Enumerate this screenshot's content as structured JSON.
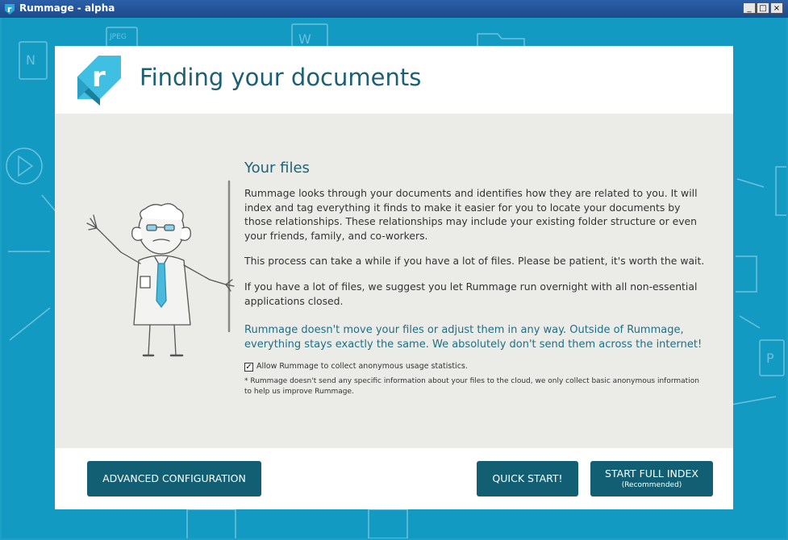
{
  "window": {
    "title": "Rummage - alpha",
    "controls": {
      "minimize": "_",
      "maximize": "□",
      "close": "×"
    }
  },
  "header": {
    "logo_letter": "r",
    "title": "Finding your documents"
  },
  "content": {
    "section_title": "Your files",
    "paragraphs": [
      "Rummage looks through your documents and identifies how they are related to you. It will index and tag everything it finds to make it easier for you to locate your documents by those relationships. These relationships may include your existing folder structure or even your friends, family, and co-workers.",
      "This process can take a while if you have a lot of files. Please be patient, it's worth the wait.",
      "If you have a lot of files, we suggest you let Rummage run overnight with all non-essential applications closed.",
      "Rummage doesn't move your files or adjust them in any way. Outside of Rummage, everything stays exactly the same. We absolutely don't send them across the internet!"
    ],
    "checkbox": {
      "label": "Allow Rummage to collect anonymous usage statistics.",
      "checked": true,
      "mark": "✓"
    },
    "footnote": "* Rummage doesn't send any specific information about your files to the cloud, we only collect basic anonymous information to help us improve Rummage."
  },
  "footer": {
    "advanced_label": "ADVANCED CONFIGURATION",
    "quick_label": "QUICK START!",
    "full_label": "START FULL INDEX",
    "full_sublabel": "(Recommended)"
  },
  "colors": {
    "background": "#139ac3",
    "button": "#125f73",
    "heading": "#1d5f73",
    "logo_light": "#3fc0e3",
    "logo_dark": "#1a7f9c"
  },
  "icons": [
    "rummage-logo-icon",
    "jpeg-file-icon",
    "word-file-icon",
    "onenote-file-icon",
    "play-icon",
    "folder-icon",
    "powerpoint-file-icon"
  ]
}
